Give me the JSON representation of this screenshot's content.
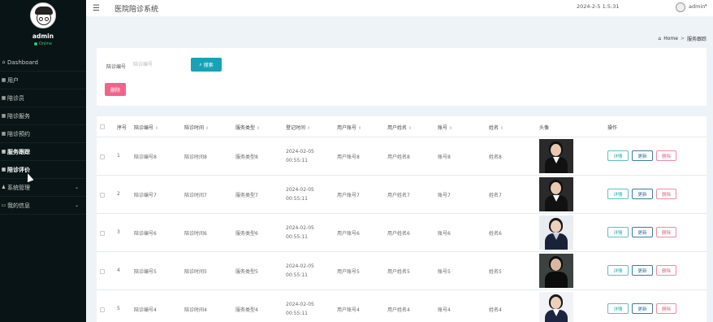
{
  "sidebar": {
    "username": "admin",
    "status": "Online",
    "items": [
      {
        "label": "Dashboard",
        "icon": "home-icon"
      },
      {
        "label": "用户",
        "icon": "grid-icon"
      },
      {
        "label": "陪诊员",
        "icon": "grid-icon"
      },
      {
        "label": "陪诊服务",
        "icon": "grid-icon"
      },
      {
        "label": "陪诊预约",
        "icon": "grid-icon"
      },
      {
        "label": "服务跟踪",
        "icon": "grid-icon",
        "active": true
      },
      {
        "label": "陪诊评价",
        "icon": "grid-icon"
      },
      {
        "label": "系统管理",
        "icon": "user-icon",
        "expandable": true
      },
      {
        "label": "我的信息",
        "icon": "card-icon",
        "expandable": true
      }
    ]
  },
  "header": {
    "title": "医院陪诊系统",
    "datetime": "2024-2-5 1:5:31",
    "user": "admin"
  },
  "breadcrumb": {
    "home": "Home",
    "separator": ">",
    "current": "服务跟踪"
  },
  "search": {
    "label": "陪诊编号",
    "placeholder": "陪诊编号",
    "button": "搜索",
    "delete_button": "删除"
  },
  "table": {
    "headers": [
      "序号",
      "陪诊编号",
      "陪诊时间",
      "服务类型",
      "登记时间",
      "用户账号",
      "用户姓名",
      "账号",
      "姓名",
      "头像",
      "操作"
    ],
    "rows": [
      {
        "no": "1",
        "code": "陪诊编号8",
        "time": "陪诊时间8",
        "type": "服务类型8",
        "reg": "2024-02-05 00:55:11",
        "uacc": "用户账号8",
        "uname": "用户姓名8",
        "acc": "账号8",
        "name": "姓名8"
      },
      {
        "no": "2",
        "code": "陪诊编号7",
        "time": "陪诊时间7",
        "type": "服务类型7",
        "reg": "2024-02-05 00:55:11",
        "uacc": "用户账号7",
        "uname": "用户姓名7",
        "acc": "账号7",
        "name": "姓名7"
      },
      {
        "no": "3",
        "code": "陪诊编号6",
        "time": "陪诊时间6",
        "type": "服务类型6",
        "reg": "2024-02-05 00:55:11",
        "uacc": "用户账号6",
        "uname": "用户姓名6",
        "acc": "账号6",
        "name": "姓名6"
      },
      {
        "no": "4",
        "code": "陪诊编号5",
        "time": "陪诊时间5",
        "type": "服务类型5",
        "reg": "2024-02-05 00:55:11",
        "uacc": "用户账号5",
        "uname": "用户姓名5",
        "acc": "账号5",
        "name": "姓名5"
      },
      {
        "no": "5",
        "code": "陪诊编号4",
        "time": "陪诊时间4",
        "type": "服务类型4",
        "reg": "2024-02-05 00:55:11",
        "uacc": "用户账号4",
        "uname": "用户姓名4",
        "acc": "账号4",
        "name": "姓名4"
      }
    ],
    "actions": {
      "detail": "详情",
      "update": "更新",
      "delete": "删除"
    }
  },
  "colors": {
    "sidebar_bg": "#081415",
    "primary": "#17a2b8",
    "danger": "#f0648c",
    "page_bg": "#eef3f8"
  }
}
